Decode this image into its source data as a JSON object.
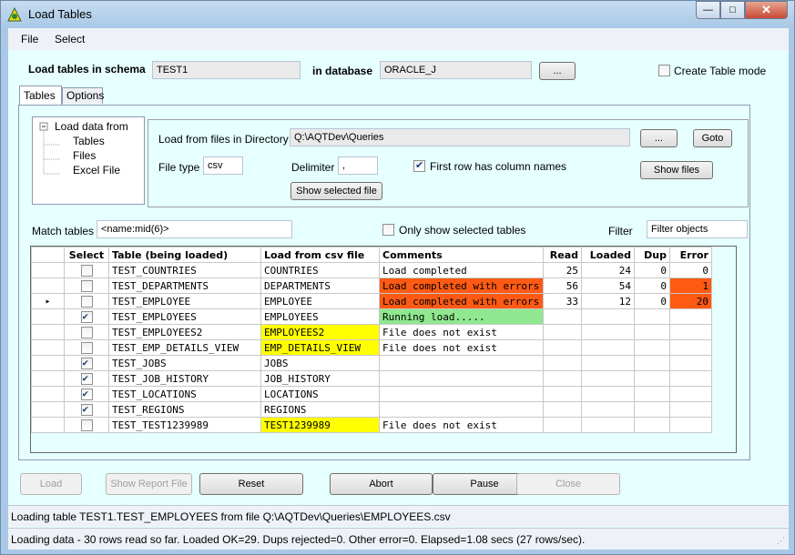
{
  "window": {
    "title": "Load Tables"
  },
  "menu": [
    "File",
    "Select"
  ],
  "schema": {
    "label": "Load tables in schema",
    "value": "TEST1",
    "db_label": "in database",
    "db_value": "ORACLE_J",
    "browse_label": "...",
    "create_table_mode_label": "Create Table mode",
    "create_table_mode_checked": false
  },
  "tabs": [
    "Tables",
    "Options"
  ],
  "tree": {
    "root": "Load data from",
    "items": [
      "Tables",
      "Files",
      "Excel File"
    ]
  },
  "files": {
    "dir_label": "Load from files in Directory",
    "dir_value": "Q:\\AQTDev\\Queries",
    "browse_label": "...",
    "goto_label": "Goto",
    "filetype_label": "File type",
    "filetype_value": "csv",
    "delim_label": "Delimiter",
    "delim_value": ",",
    "first_row_label": "First row has column names",
    "first_row_checked": true,
    "show_files_label": "Show files",
    "show_selected_label": "Show selected file"
  },
  "match": {
    "label": "Match tables",
    "value": "<name:mid(6)>",
    "only_selected_label": "Only show selected tables",
    "only_selected_checked": false,
    "filter_label": "Filter",
    "filter_placeholder": "Filter objects"
  },
  "grid": {
    "columns": [
      "Select",
      "Table (being loaded)",
      "Load from csv file",
      "Comments",
      "Read",
      "Loaded",
      "Dup",
      "Error"
    ],
    "current_row_marker": "▸",
    "rows": [
      {
        "selected": false,
        "table": "TEST_COUNTRIES",
        "file": "COUNTRIES",
        "comment": "Load completed",
        "read": "25",
        "loaded": "24",
        "dup": "0",
        "error": "0",
        "comment_status": "",
        "file_status": "",
        "error_status": "",
        "current": false
      },
      {
        "selected": false,
        "table": "TEST_DEPARTMENTS",
        "file": "DEPARTMENTS",
        "comment": "Load completed with errors",
        "read": "56",
        "loaded": "54",
        "dup": "0",
        "error": "1",
        "comment_status": "error",
        "file_status": "",
        "error_status": "error",
        "current": false
      },
      {
        "selected": false,
        "table": "TEST_EMPLOYEE",
        "file": "EMPLOYEE",
        "comment": "Load completed with errors",
        "read": "33",
        "loaded": "12",
        "dup": "0",
        "error": "20",
        "comment_status": "error",
        "file_status": "",
        "error_status": "error",
        "current": true
      },
      {
        "selected": true,
        "table": "TEST_EMPLOYEES",
        "file": "EMPLOYEES",
        "comment": "Running load.....",
        "read": "",
        "loaded": "",
        "dup": "",
        "error": "",
        "comment_status": "running",
        "file_status": "",
        "error_status": "",
        "current": false
      },
      {
        "selected": false,
        "table": "TEST_EMPLOYEES2",
        "file": "EMPLOYEES2",
        "comment": "File does not exist",
        "read": "",
        "loaded": "",
        "dup": "",
        "error": "",
        "comment_status": "",
        "file_status": "missing",
        "error_status": "",
        "current": false
      },
      {
        "selected": false,
        "table": "TEST_EMP_DETAILS_VIEW",
        "file": "EMP_DETAILS_VIEW",
        "comment": "File does not exist",
        "read": "",
        "loaded": "",
        "dup": "",
        "error": "",
        "comment_status": "",
        "file_status": "missing",
        "error_status": "",
        "current": false
      },
      {
        "selected": true,
        "table": "TEST_JOBS",
        "file": "JOBS",
        "comment": "",
        "read": "",
        "loaded": "",
        "dup": "",
        "error": "",
        "comment_status": "",
        "file_status": "",
        "error_status": "",
        "current": false
      },
      {
        "selected": true,
        "table": "TEST_JOB_HISTORY",
        "file": "JOB_HISTORY",
        "comment": "",
        "read": "",
        "loaded": "",
        "dup": "",
        "error": "",
        "comment_status": "",
        "file_status": "",
        "error_status": "",
        "current": false
      },
      {
        "selected": true,
        "table": "TEST_LOCATIONS",
        "file": "LOCATIONS",
        "comment": "",
        "read": "",
        "loaded": "",
        "dup": "",
        "error": "",
        "comment_status": "",
        "file_status": "",
        "error_status": "",
        "current": false
      },
      {
        "selected": true,
        "table": "TEST_REGIONS",
        "file": "REGIONS",
        "comment": "",
        "read": "",
        "loaded": "",
        "dup": "",
        "error": "",
        "comment_status": "",
        "file_status": "",
        "error_status": "",
        "current": false
      },
      {
        "selected": false,
        "table": "TEST_TEST1239989",
        "file": "TEST1239989",
        "comment": "File does not exist",
        "read": "",
        "loaded": "",
        "dup": "",
        "error": "",
        "comment_status": "",
        "file_status": "missing",
        "error_status": "",
        "current": false
      }
    ]
  },
  "buttons": {
    "load": "Load",
    "show_report": "Show Report File",
    "reset": "Reset",
    "abort": "Abort",
    "pause": "Pause",
    "close": "Close"
  },
  "status": {
    "line1": "Loading table TEST1.TEST_EMPLOYEES from file Q:\\AQTDev\\Queries\\EMPLOYEES.csv",
    "line2": "Loading data - 30 rows read so far. Loaded OK=29. Dups rejected=0. Other error=0. Elapsed=1.08 secs (27 rows/sec)."
  },
  "colors": {
    "error": "#ff5a14",
    "running": "#8fe88f",
    "missing": "#ffff00",
    "client_bg": "#e6ffff"
  }
}
